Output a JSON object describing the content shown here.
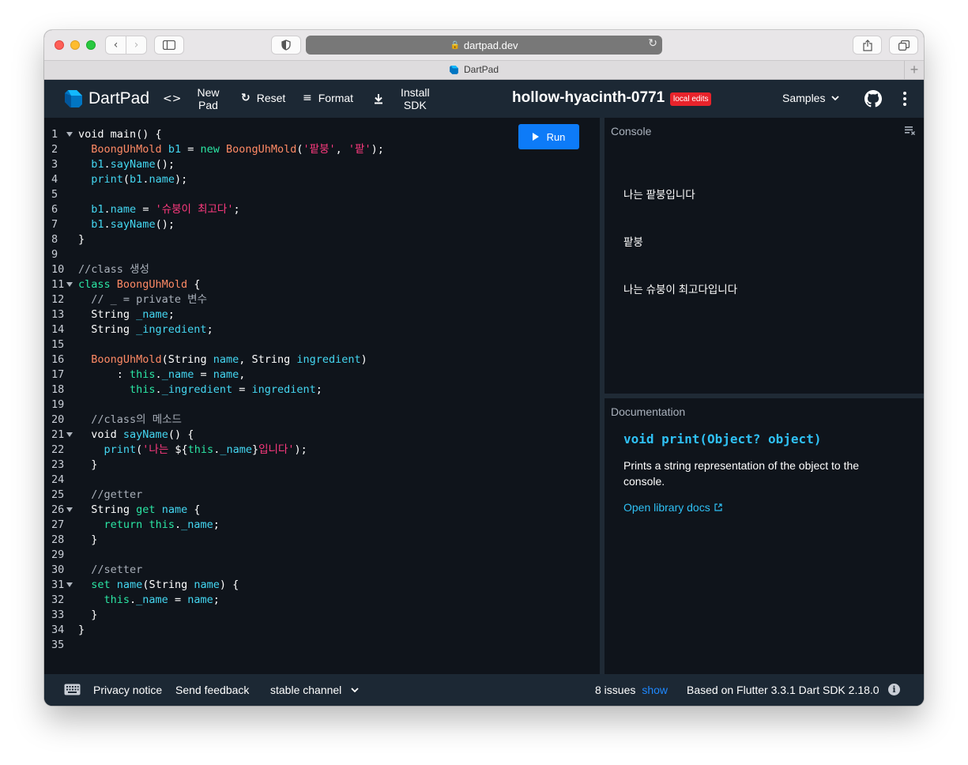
{
  "browser": {
    "url": "dartpad.dev",
    "tab_title": "DartPad"
  },
  "header": {
    "brand": "DartPad",
    "new_pad": [
      "New",
      "Pad"
    ],
    "reset": "Reset",
    "format": "Format",
    "install_sdk": [
      "Install",
      "SDK"
    ],
    "project_title": "hollow-hyacinth-0771",
    "badge": "local edits",
    "samples": "Samples"
  },
  "editor": {
    "run_label": "Run",
    "line_numbers": [
      "1",
      "2",
      "3",
      "4",
      "5",
      "6",
      "7",
      "8",
      "9",
      "10",
      "11",
      "12",
      "13",
      "14",
      "15",
      "16",
      "17",
      "18",
      "19",
      "20",
      "21",
      "22",
      "23",
      "24",
      "25",
      "26",
      "27",
      "28",
      "29",
      "30",
      "31",
      "32",
      "33",
      "34",
      "35"
    ]
  },
  "console": {
    "label": "Console",
    "output": [
      "나는 팥붕입니다",
      "팥붕",
      "나는 슈붕이 최고다입니다"
    ]
  },
  "documentation": {
    "label": "Documentation",
    "signature": "void print(Object? object)",
    "description": "Prints a string representation of the object to the console.",
    "link": "Open library docs"
  },
  "footer": {
    "privacy": "Privacy notice",
    "feedback": "Send feedback",
    "channel": "stable channel",
    "issues": "8 issues",
    "show": "show",
    "sdk_info": "Based on Flutter 3.3.1 Dart SDK 2.18.0"
  },
  "colors": {
    "accent_blue": "#0d7bf8",
    "header_bg": "#1c2834",
    "editor_bg": "#0f141b",
    "badge_red": "#e8232b"
  }
}
